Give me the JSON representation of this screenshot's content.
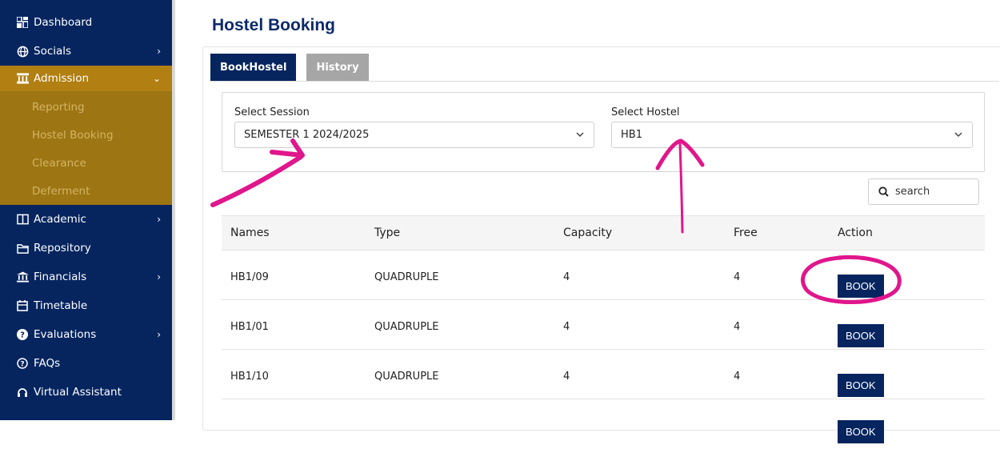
{
  "sidebar": {
    "items": [
      {
        "label": "Dashboard",
        "icon": "dashboard-icon",
        "chevron": ""
      },
      {
        "label": "Socials",
        "icon": "globe-icon",
        "chevron": "›"
      },
      {
        "label": "Admission",
        "icon": "institution-icon",
        "chevron": "⌄"
      },
      {
        "label": "Academic",
        "icon": "book-icon",
        "chevron": "›"
      },
      {
        "label": "Repository",
        "icon": "folder-icon",
        "chevron": ""
      },
      {
        "label": "Financials",
        "icon": "bank-icon",
        "chevron": "›"
      },
      {
        "label": "Timetable",
        "icon": "calendar-icon",
        "chevron": ""
      },
      {
        "label": "Evaluations",
        "icon": "question-circle-icon",
        "chevron": "›"
      },
      {
        "label": "FAQs",
        "icon": "help-circle-icon",
        "chevron": ""
      },
      {
        "label": "Virtual Assistant",
        "icon": "headset-icon",
        "chevron": ""
      }
    ],
    "submenu": [
      "Reporting",
      "Hostel Booking",
      "Clearance",
      "Deferment"
    ]
  },
  "page": {
    "title": "Hostel Booking"
  },
  "tabs": {
    "book": "BookHostel",
    "history": "History"
  },
  "filters": {
    "session_label": "Select Session",
    "session_value": "SEMESTER 1 2024/2025",
    "hostel_label": "Select Hostel",
    "hostel_value": "HB1"
  },
  "search": {
    "placeholder": "search"
  },
  "table": {
    "headers": [
      "Names",
      "Type",
      "Capacity",
      "Free",
      "Action"
    ],
    "rows": [
      {
        "name": "HB1/09",
        "type": "QUADRUPLE",
        "capacity": "4",
        "free": "4",
        "action": "BOOK"
      },
      {
        "name": "HB1/01",
        "type": "QUADRUPLE",
        "capacity": "4",
        "free": "4",
        "action": "BOOK"
      },
      {
        "name": "HB1/10",
        "type": "QUADRUPLE",
        "capacity": "4",
        "free": "4",
        "action": "BOOK"
      }
    ]
  },
  "colors": {
    "sidebar_bg": "#06255f",
    "sidebar_active": "#b17f12",
    "submenu_bg": "#9d7512",
    "accent_navy": "#06255f",
    "annotation_pink": "#e0168c"
  }
}
